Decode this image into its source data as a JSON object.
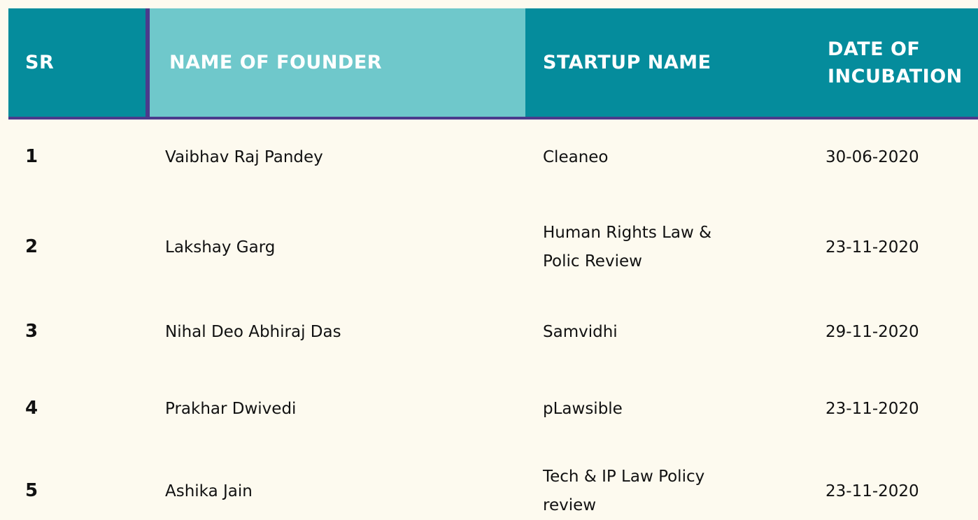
{
  "table": {
    "headers": {
      "sr": "SR",
      "founder": "NAME OF FOUNDER",
      "startup": "STARTUP NAME",
      "date_line1": "DATE OF",
      "date_line2": "INCUBATION"
    },
    "rows": [
      {
        "sr": "1",
        "founder": "Vaibhav Raj Pandey",
        "startup_line1": "Cleaneo",
        "startup_line2": "",
        "date": "30-06-2020"
      },
      {
        "sr": "2",
        "founder": "Lakshay Garg",
        "startup_line1": "Human Rights Law &",
        "startup_line2": "Polic Review",
        "date": "23-11-2020"
      },
      {
        "sr": "3",
        "founder": "Nihal Deo Abhiraj Das",
        "startup_line1": "Samvidhi",
        "startup_line2": "",
        "date": "29-11-2020"
      },
      {
        "sr": "4",
        "founder": "Prakhar Dwivedi",
        "startup_line1": "pLawsible",
        "startup_line2": "",
        "date": "23-11-2020"
      },
      {
        "sr": "5",
        "founder": "Ashika Jain",
        "startup_line1": "Tech & IP Law Policy",
        "startup_line2": "review",
        "date": "23-11-2020"
      }
    ],
    "colors": {
      "header_teal": "#058c9c",
      "header_light_teal": "#6fc8cb",
      "accent_purple": "#4b3b8c",
      "background": "#fdfaef"
    }
  }
}
